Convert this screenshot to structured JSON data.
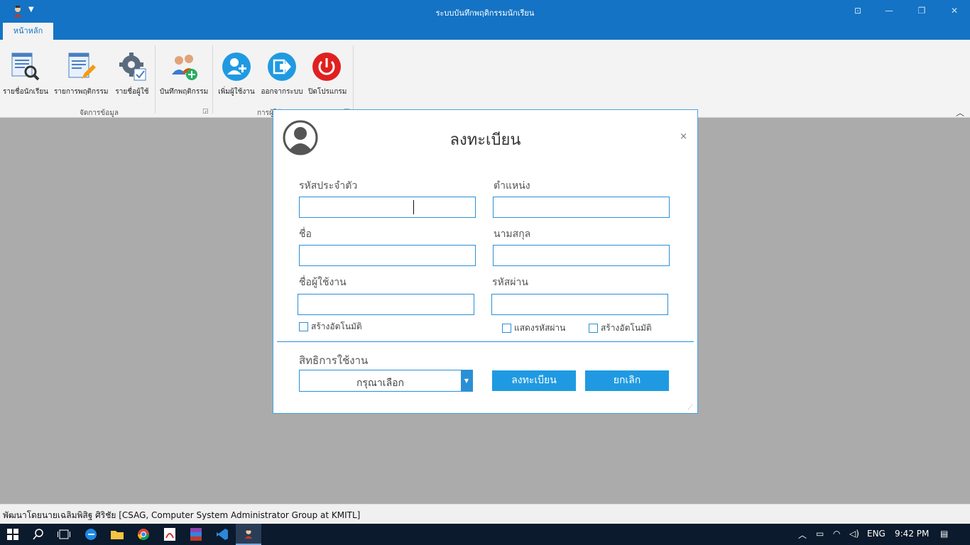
{
  "window": {
    "title": "ระบบบันทึกพฤติกรรมนักเรียน"
  },
  "tabs": [
    {
      "label": "หน้าหลัก",
      "active": true
    }
  ],
  "ribbon": {
    "groups": [
      {
        "label": "จัดการข้อมูล",
        "buttons": [
          {
            "label": "รายชื่อนักเรียน",
            "icon": "student-search-icon"
          },
          {
            "label": "รายการพฤติกรรม",
            "icon": "edit-list-icon"
          },
          {
            "label": "รายชื่อผู้ใช้",
            "icon": "settings-users-icon"
          },
          {
            "label": "บันทึกพฤติกรรม",
            "icon": "add-users-icon"
          }
        ]
      },
      {
        "label": "การผู้ใช้",
        "buttons": [
          {
            "label": "เพิ่มผู้ใช้งาน",
            "icon": "add-user-icon"
          },
          {
            "label": "ออกจากระบบ",
            "icon": "logout-icon"
          },
          {
            "label": "ปิดโปรแกรม",
            "icon": "power-icon"
          }
        ]
      }
    ]
  },
  "dialog": {
    "title": "ลงทะเบียน",
    "close": "×",
    "fields": {
      "id_label": "รหัสประจำตัว",
      "position_label": "ตำแหน่ง",
      "firstname_label": "ชื่อ",
      "lastname_label": "นามสกุล",
      "username_label": "ชื่อผู้ใช้งาน",
      "password_label": "รหัสผ่าน"
    },
    "checkboxes": {
      "auto_username": "สร้างอัตโนมัติ",
      "show_password": "แสดงรหัสผ่าน",
      "auto_password": "สร้างอัตโนมัติ"
    },
    "permission_label": "สิทธิการใช้งาน",
    "permission_selected": "กรุณาเลือก",
    "register_button": "ลงทะเบียน",
    "cancel_button": "ยกเลิก"
  },
  "statusbar": {
    "text": "พัฒนาโดยนายเฉลิมพิสิฐ ศิริชัย [CSAG, Computer System Administrator Group at KMITL]"
  },
  "taskbar": {
    "language": "ENG",
    "time": "9:42 PM"
  },
  "colors": {
    "titlebar": "#1473c4",
    "accent": "#2b8fd6",
    "button": "#1f9ae2",
    "power": "#e02020"
  }
}
